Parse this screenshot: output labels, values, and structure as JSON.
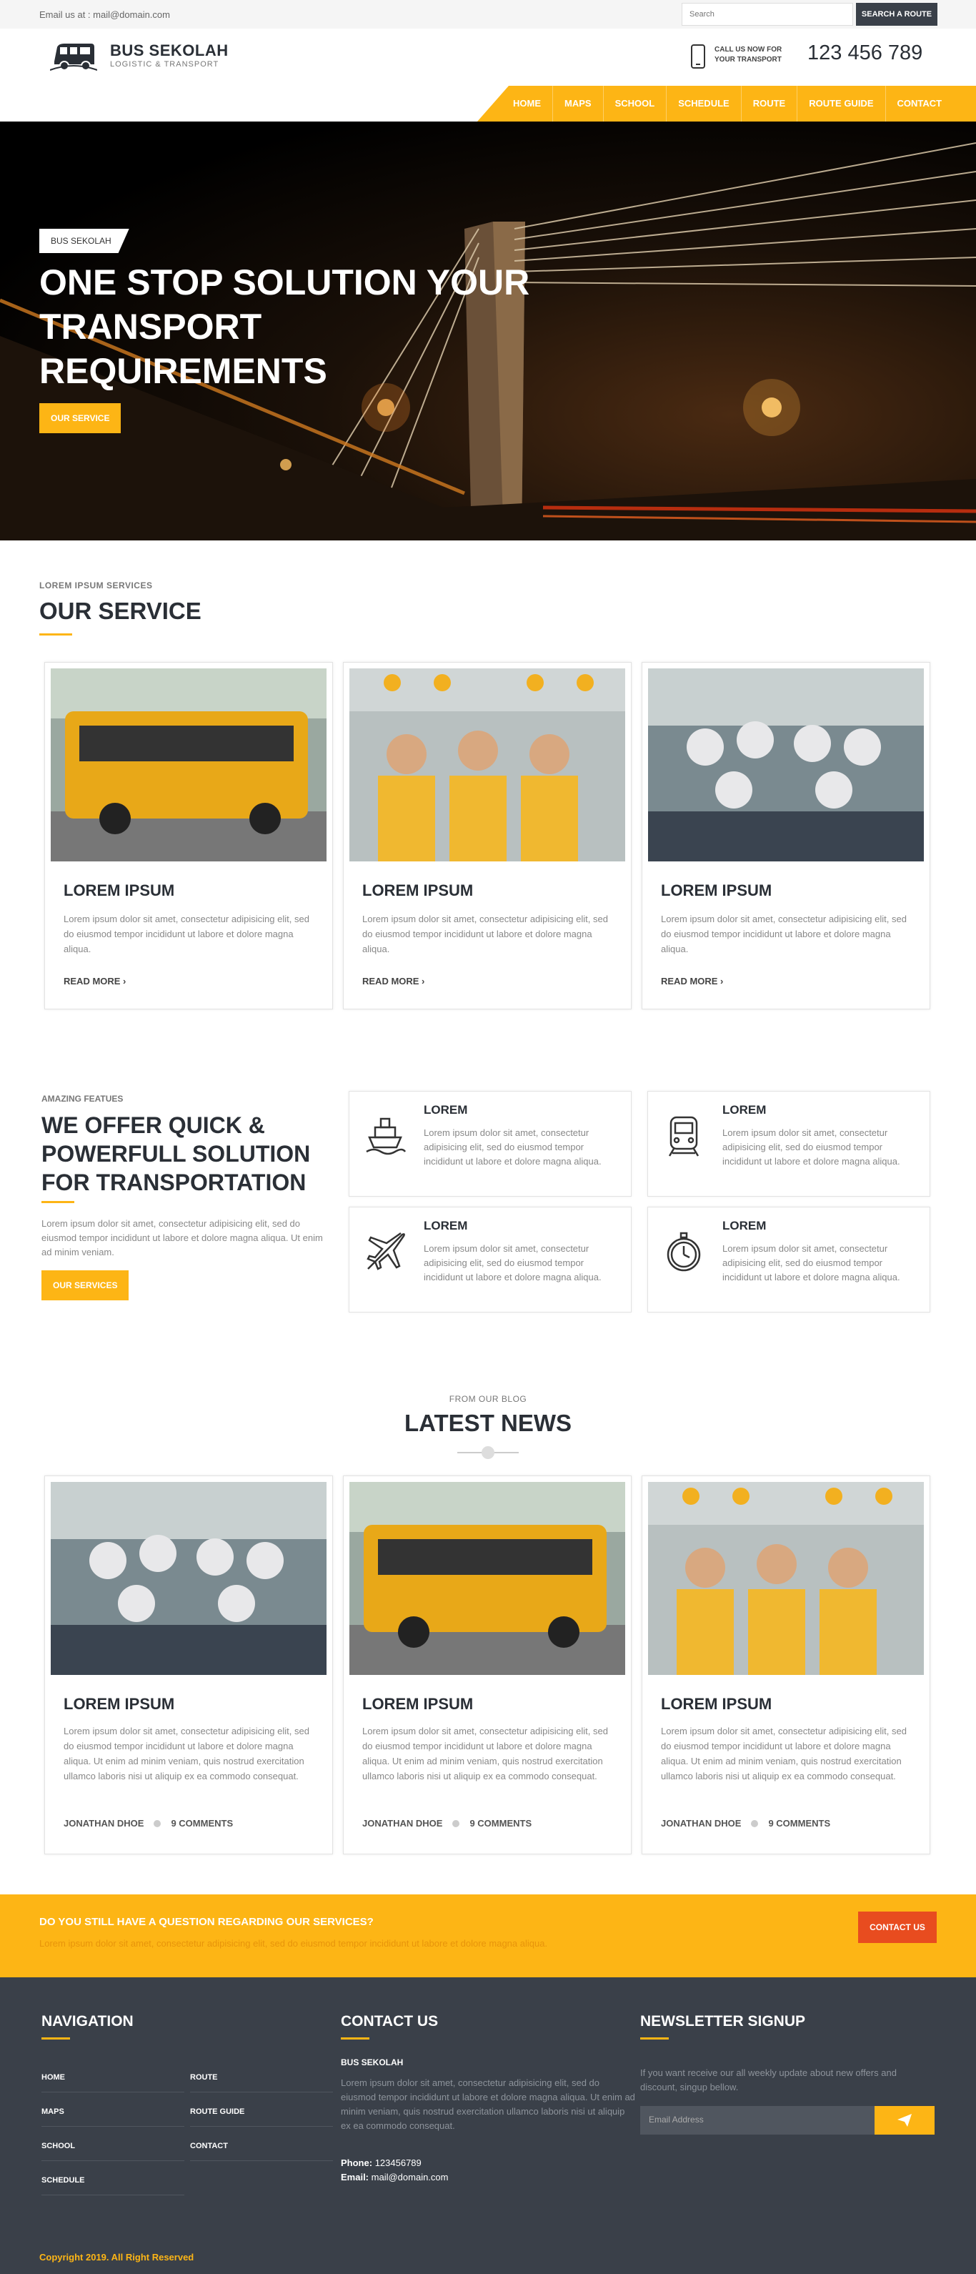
{
  "topbar": {
    "email": "Email us at : mail@domain.com",
    "search_placeholder": "Search",
    "search_button": "SEARCH A ROUTE"
  },
  "header": {
    "brand": "BUS SEKOLAH",
    "tagline": "LOGISTIC & TRANSPORT",
    "call_line1": "CALL US NOW FOR",
    "call_line2": "YOUR TRANSPORT",
    "phone": "123 456 789"
  },
  "nav": {
    "items": [
      "HOME",
      "MAPS",
      "SCHOOL",
      "SCHEDULE",
      "ROUTE",
      "ROUTE GUIDE",
      "CONTACT"
    ]
  },
  "hero": {
    "tag": "BUS SEKOLAH",
    "title": "ONE STOP SOLUTION YOUR TRANSPORT REQUIREMENTS",
    "button": "OUR SERVICE"
  },
  "services": {
    "kicker": "LOREM IPSUM SERVICES",
    "title": "OUR SERVICE",
    "cards": [
      {
        "title": "LOREM IPSUM",
        "text": "Lorem ipsum dolor sit amet, consectetur adipisicing elit, sed do eiusmod tempor incididunt ut labore et dolore magna aliqua.",
        "more": "READ MORE ›"
      },
      {
        "title": "LOREM IPSUM",
        "text": "Lorem ipsum dolor sit amet, consectetur adipisicing elit, sed do eiusmod tempor incididunt ut labore et dolore magna aliqua.",
        "more": "READ MORE ›"
      },
      {
        "title": "LOREM IPSUM",
        "text": "Lorem ipsum dolor sit amet, consectetur adipisicing elit, sed do eiusmod tempor incididunt ut labore et dolore magna aliqua.",
        "more": "READ MORE ›"
      }
    ]
  },
  "features": {
    "kicker": "AMAZING FEATUES",
    "title": "WE OFFER QUICK & POWERFULL SOLUTION FOR TRANSPORTATION",
    "text": "Lorem ipsum dolor sit amet, consectetur adipisicing elit, sed do eiusmod tempor incididunt ut labore et dolore magna aliqua. Ut enim ad minim veniam.",
    "button": "OUR SERVICES",
    "boxes": [
      {
        "title": "LOREM",
        "text": "Lorem ipsum dolor sit amet, consectetur adipisicing elit, sed do eiusmod tempor incididunt ut labore et dolore magna aliqua.",
        "icon": "ship-icon"
      },
      {
        "title": "LOREM",
        "text": "Lorem ipsum dolor sit amet, consectetur adipisicing elit, sed do eiusmod tempor incididunt ut labore et dolore magna aliqua.",
        "icon": "train-icon"
      },
      {
        "title": "LOREM",
        "text": "Lorem ipsum dolor sit amet, consectetur adipisicing elit, sed do eiusmod tempor incididunt ut labore et dolore magna aliqua.",
        "icon": "airplane-icon"
      },
      {
        "title": "LOREM",
        "text": "Lorem ipsum dolor sit amet, consectetur adipisicing elit, sed do eiusmod tempor incididunt ut labore et dolore magna aliqua.",
        "icon": "stopwatch-icon"
      }
    ]
  },
  "news": {
    "kicker": "FROM OUR BLOG",
    "title": "LATEST NEWS",
    "cards": [
      {
        "title": "LOREM IPSUM",
        "text": "Lorem ipsum dolor sit amet, consectetur adipisicing elit, sed do eiusmod tempor incididunt ut labore et dolore magna aliqua. Ut enim ad minim veniam, quis nostrud exercitation ullamco laboris nisi ut aliquip ex ea commodo consequat.",
        "author": "JONATHAN DHOE",
        "comments": "9 COMMENTS"
      },
      {
        "title": "LOREM IPSUM",
        "text": "Lorem ipsum dolor sit amet, consectetur adipisicing elit, sed do eiusmod tempor incididunt ut labore et dolore magna aliqua. Ut enim ad minim veniam, quis nostrud exercitation ullamco laboris nisi ut aliquip ex ea commodo consequat.",
        "author": "JONATHAN DHOE",
        "comments": "9 COMMENTS"
      },
      {
        "title": "LOREM IPSUM",
        "text": "Lorem ipsum dolor sit amet, consectetur adipisicing elit, sed do eiusmod tempor incididunt ut labore et dolore magna aliqua. Ut enim ad minim veniam, quis nostrud exercitation ullamco laboris nisi ut aliquip ex ea commodo consequat.",
        "author": "JONATHAN DHOE",
        "comments": "9 COMMENTS"
      }
    ]
  },
  "cta": {
    "title": "DO YOU STILL HAVE A QUESTION REGARDING OUR SERVICES?",
    "text": "Lorem ipsum dolor sit amet, consectetur adipisicing elit, sed do eiusmod tempor incididunt ut labore et dolore magna aliqua.",
    "button": "CONTACT US"
  },
  "footer": {
    "nav_title": "NAVIGATION",
    "nav_col1": [
      "HOME",
      "MAPS",
      "SCHOOL",
      "SCHEDULE"
    ],
    "nav_col2": [
      "ROUTE",
      "ROUTE GUIDE",
      "CONTACT"
    ],
    "contact_title": "CONTACT US",
    "contact_name": "BUS SEKOLAH",
    "contact_text": "Lorem ipsum dolor sit amet, consectetur adipisicing elit, sed do eiusmod tempor incididunt ut labore et dolore magna aliqua. Ut enim ad minim veniam, quis nostrud exercitation ullamco laboris nisi ut aliquip ex ea commodo consequat.",
    "phone_label": "Phone:",
    "phone": "123456789",
    "email_label": "Email:",
    "email": "mail@domain.com",
    "newsletter_title": "NEWSLETTER SIGNUP",
    "newsletter_text": "If you want receive our all weekly update about new offers and discount, singup bellow.",
    "newsletter_placeholder": "Email Address",
    "copyright": "Copyright 2019. All Right Reserved"
  },
  "colors": {
    "accent": "#fdb515",
    "dark": "#3a4049",
    "cta_button": "#e84c1f"
  }
}
